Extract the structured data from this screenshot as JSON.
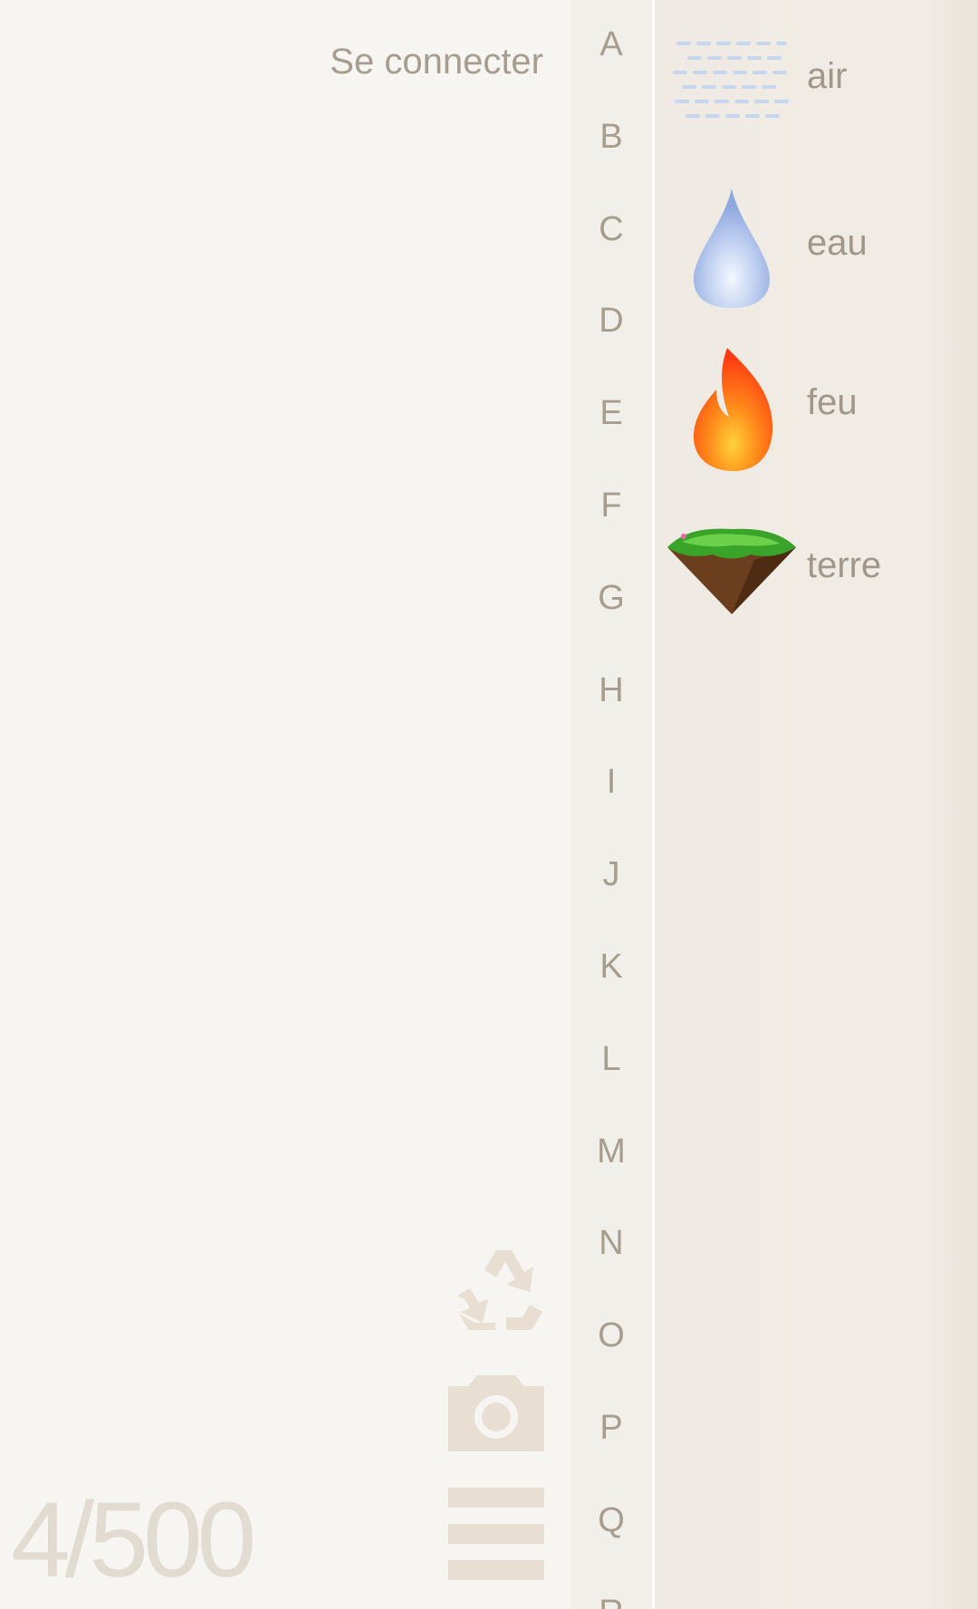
{
  "header": {
    "login_label": "Se connecter"
  },
  "alphabet": [
    "A",
    "B",
    "C",
    "D",
    "E",
    "F",
    "G",
    "H",
    "I",
    "J",
    "K",
    "L",
    "M",
    "N",
    "O",
    "P",
    "Q",
    "R"
  ],
  "elements": [
    {
      "label": "air",
      "icon": "air-icon"
    },
    {
      "label": "eau",
      "icon": "water-drop-icon"
    },
    {
      "label": "feu",
      "icon": "fire-icon"
    },
    {
      "label": "terre",
      "icon": "earth-icon"
    }
  ],
  "tools": [
    {
      "name": "recycle",
      "icon": "recycle-icon"
    },
    {
      "name": "camera",
      "icon": "camera-icon"
    },
    {
      "name": "menu",
      "icon": "menu-icon"
    }
  ],
  "counter": {
    "text": "4/500"
  },
  "colors": {
    "text": "#a79d8e",
    "tool": "#e8ded2",
    "counter": "#e2dbd1"
  }
}
